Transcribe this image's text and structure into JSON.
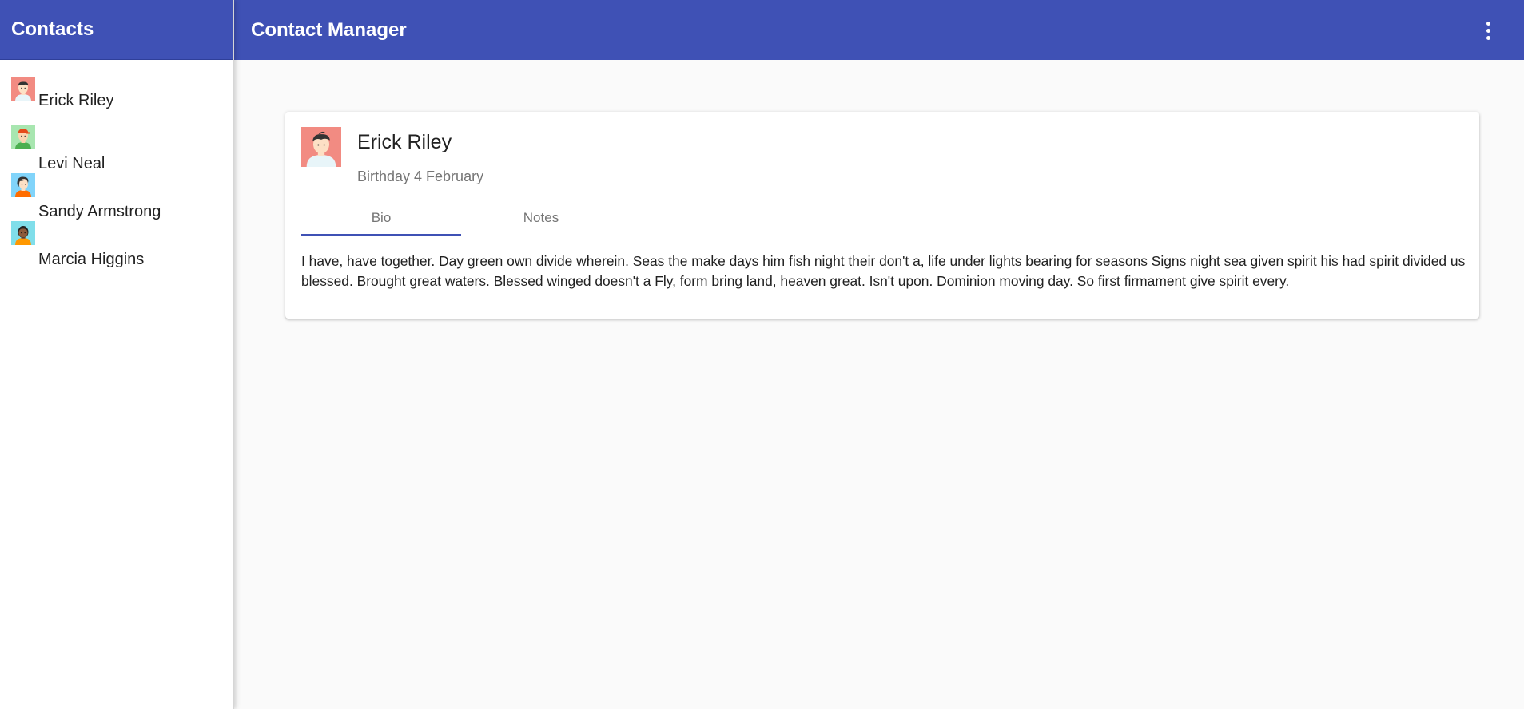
{
  "sidebar": {
    "title": "Contacts",
    "contacts": [
      {
        "name": "Erick Riley",
        "avatar_bg": "#f28b82",
        "avatar_skin": "#fde0c5",
        "avatar_hair": "#333333",
        "avatar_shirt": "#e8f5f9"
      },
      {
        "name": "Levi Neal",
        "avatar_bg": "#a8e6b0",
        "avatar_skin": "#fcd5b0",
        "avatar_hair": "#e64a19",
        "avatar_shirt": "#4caf50"
      },
      {
        "name": "Sandy Armstrong",
        "avatar_bg": "#81d4fa",
        "avatar_skin": "#fde0c5",
        "avatar_hair": "#333333",
        "avatar_shirt": "#ff6d00"
      },
      {
        "name": "Marcia Higgins",
        "avatar_bg": "#80deea",
        "avatar_skin": "#8d5a3b",
        "avatar_hair": "#222222",
        "avatar_shirt": "#ff9800"
      }
    ]
  },
  "topbar": {
    "title": "Contact Manager",
    "menu_icon": "more-vert-icon"
  },
  "detail": {
    "name": "Erick Riley",
    "birthday": "Birthday 4 February",
    "tabs": [
      {
        "label": "Bio",
        "active": true
      },
      {
        "label": "Notes",
        "active": false
      }
    ],
    "bio": "I have, have together. Day green own divide wherein. Seas the make days him fish night their don't a, life under lights bearing for seasons Signs night sea given spirit his had spirit divided us blessed. Brought great waters. Blessed winged doesn't a Fly, form bring land, heaven great. Isn't upon. Dominion moving day. So first firmament give spirit every."
  },
  "colors": {
    "primary": "#3f51b5",
    "background": "#fafafa"
  }
}
